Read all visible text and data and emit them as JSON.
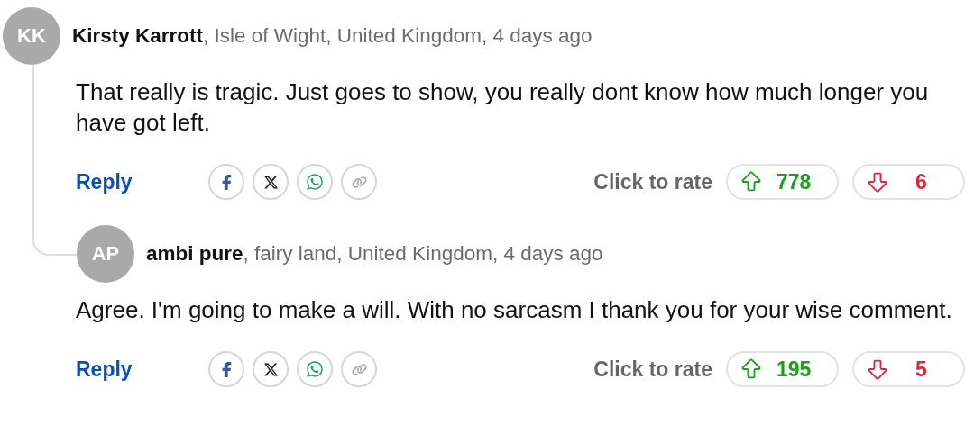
{
  "comments": [
    {
      "initials": "KK",
      "byline": "**Kirsty Karrott**, Isle of Wight, United Kingdom, 4 days ago",
      "text": "That really is tragic. Just goes to show, you really dont know how much longer you have got left.",
      "reply": "Reply",
      "rate_label": "Click to rate",
      "upvotes": "778",
      "downvotes": "6",
      "replies": [
        {
          "initials": "AP",
          "byline": "**ambi pure**, fairy land, United Kingdom, 4 days ago",
          "text": "Agree. I'm going to make a will. With no sarcasm I thank you for your wise comment.",
          "reply": "Reply",
          "rate_label": "Click to rate",
          "upvotes": "195",
          "downvotes": "5"
        }
      ]
    }
  ]
}
